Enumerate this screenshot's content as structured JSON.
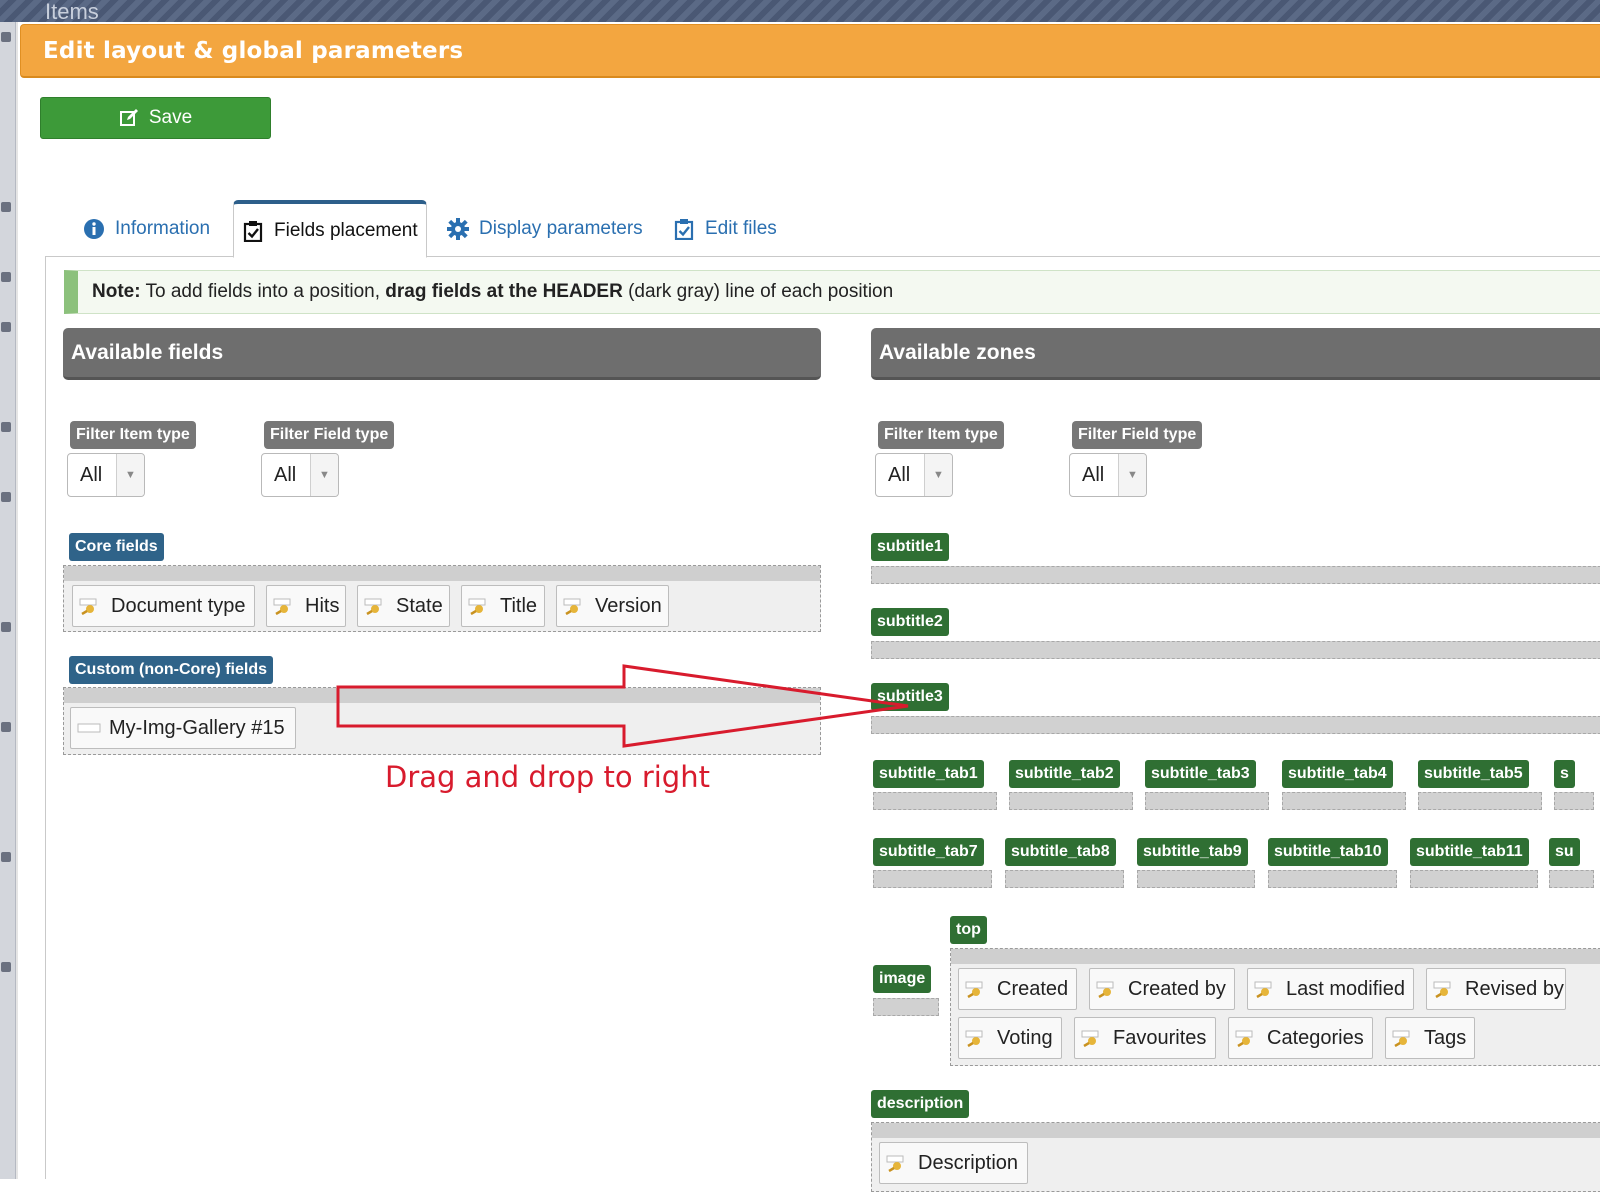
{
  "background": {
    "title": "Items"
  },
  "modal": {
    "title": "Edit layout & global parameters",
    "save_label": "Save"
  },
  "tabs": [
    {
      "label": "Information",
      "icon": "info-icon"
    },
    {
      "label": "Fields placement",
      "icon": "checklist-icon",
      "active": true
    },
    {
      "label": "Display parameters",
      "icon": "gear-icon"
    },
    {
      "label": "Edit files",
      "icon": "checklist-icon"
    }
  ],
  "note": {
    "label": "Note:",
    "text1": "To add fields into a position,",
    "bold": "drag fields at the HEADER",
    "text2": "(dark gray) line of each position"
  },
  "available_fields": {
    "title": "Available fields",
    "filter_item_type_label": "Filter Item type",
    "filter_item_type_value": "All",
    "filter_field_type_label": "Filter Field type",
    "filter_field_type_value": "All",
    "core_label": "Core fields",
    "core_fields": [
      "Document type",
      "Hits",
      "State",
      "Title",
      "Version"
    ],
    "custom_label": "Custom (non-Core) fields",
    "custom_fields": [
      "My-Img-Gallery #15"
    ]
  },
  "available_zones": {
    "title": "Available zones",
    "filter_item_type_label": "Filter Item type",
    "filter_item_type_value": "All",
    "filter_field_type_label": "Filter Field type",
    "filter_field_type_value": "All",
    "subtitles": [
      "subtitle1",
      "subtitle2",
      "subtitle3"
    ],
    "tabs_row1": [
      "subtitle_tab1",
      "subtitle_tab2",
      "subtitle_tab3",
      "subtitle_tab4",
      "subtitle_tab5",
      "s"
    ],
    "tabs_row2": [
      "subtitle_tab7",
      "subtitle_tab8",
      "subtitle_tab9",
      "subtitle_tab10",
      "subtitle_tab11",
      "su"
    ],
    "top_label": "top",
    "image_label": "image",
    "top_fields_row1": [
      "Created",
      "Created by",
      "Last modified",
      "Revised by"
    ],
    "top_fields_row2": [
      "Voting",
      "Favourites",
      "Categories",
      "Tags"
    ],
    "description_label": "description",
    "description_fields": [
      "Description"
    ]
  },
  "annotation": {
    "text": "Drag and drop to right",
    "color": "#d81b2d"
  },
  "colors": {
    "header_orange": "#f3a640",
    "save_green": "#3d9a39",
    "zone_green": "#2f6f33",
    "core_blue": "#2f6389"
  }
}
